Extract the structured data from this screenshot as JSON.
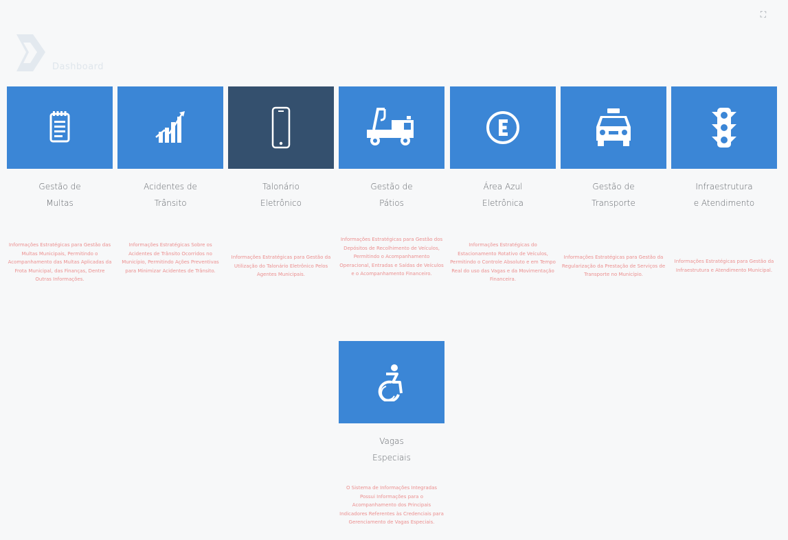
{
  "logo": {
    "text": "Dashboard"
  },
  "toolbar": {
    "fullscreen_icon": "expand-icon",
    "fullscreen_glyph": "⛶"
  },
  "modules": [
    {
      "title": "Gestão de\nMultas",
      "icon": "notepad-icon",
      "description": "Informações Estratégicas para Gestão das Multas Municipais, Permitindo o Acompanhamento das Multas Aplicadas da Frota Municipal, das Finanças, Dentre Outras Informações."
    },
    {
      "title": "Acidentes de\nTrânsito",
      "icon": "chart-growth-icon",
      "description": "Informações Estratégicas Sobre os Acidentes de Trânsito Ocorridos no Município, Permitindo Ações Preventivas para Minimizar Acidentes de Trânsito."
    },
    {
      "title": "Talonário\nEletrônico",
      "icon": "smartphone-icon",
      "description": "Informações Estratégicas para Gestão da Utilização do Talonário Eletrônico Pelos Agentes Municipais."
    },
    {
      "title": "Gestão de\nPátios",
      "icon": "tow-truck-icon",
      "description": "Informações Estratégicas para Gestão dos Depósitos de Recolhimento de Veículos, Permitindo o Acompanhamento Operacional, Entradas e Saídas de Veículos e o Acompanhamento Financeiro."
    },
    {
      "title": "Área Azul\nEletrônica",
      "icon": "parking-e-icon",
      "description": "Informações Estratégicas do Estacionamento Rotativo de Veículos, Permitindo o Controle Absoluto e em Tempo Real do uso das Vagas e da Movimentação Financeira."
    },
    {
      "title": "Gestão de\nTransporte",
      "icon": "taxi-icon",
      "description": "Informações Estratégicas para Gestão da Regularização da Prestação de Serviços de Transporte no Município."
    },
    {
      "title": "Infraestrutura\ne Atendimento",
      "icon": "traffic-light-icon",
      "description": "Informações Estratégicas para Gestão da Infraestrutura e Atendimento Municipal."
    },
    {
      "title": "Vagas\nEspeciais",
      "icon": "accessibility-icon",
      "description": "O Sistema de Informações Integradas Possui Informações para o Acompanhamento dos Principais Indicadores Referentes às Credenciais para Gerenciamento de Vagas Especiais."
    }
  ]
}
